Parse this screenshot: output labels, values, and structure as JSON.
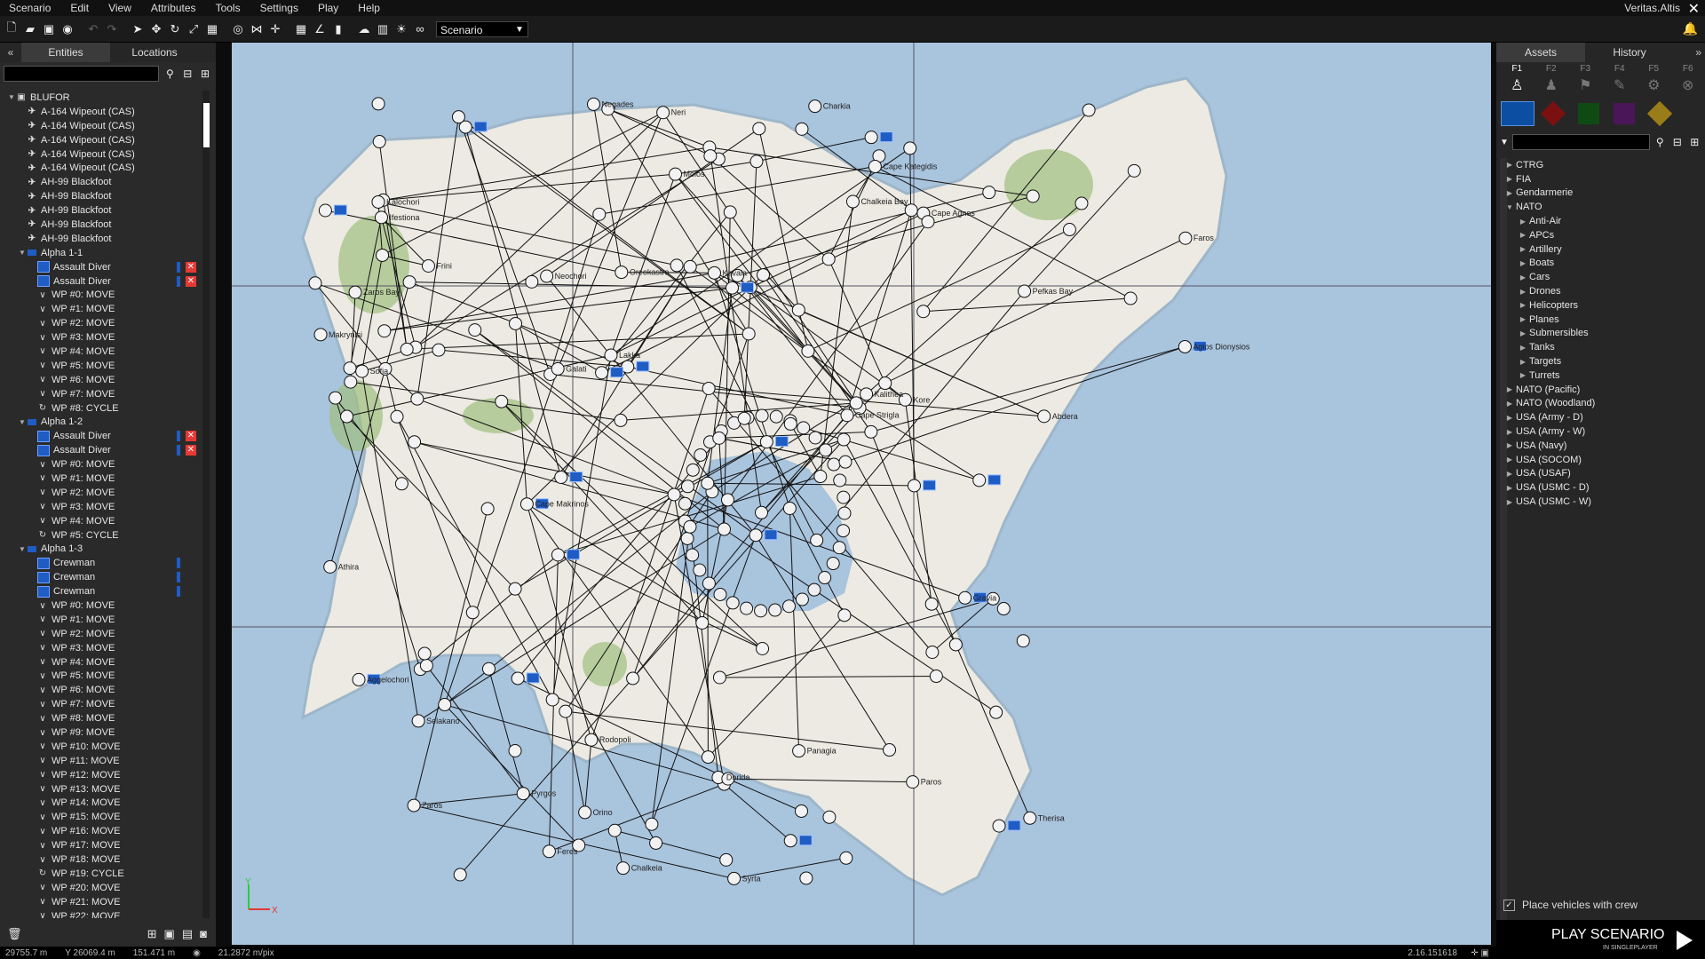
{
  "menu": [
    "Scenario",
    "Edit",
    "View",
    "Attributes",
    "Tools",
    "Settings",
    "Play",
    "Help"
  ],
  "scenario_name": "Veritas.Altis",
  "toolbar": {
    "layer_select": "Scenario"
  },
  "left_panel": {
    "tabs": [
      "Entities",
      "Locations"
    ],
    "tree": [
      {
        "level": 0,
        "toggle": "▼",
        "icon": "folder",
        "label": "BLUFOR"
      },
      {
        "level": 1,
        "icon": "plane",
        "label": "A-164 Wipeout (CAS)"
      },
      {
        "level": 1,
        "icon": "plane",
        "label": "A-164 Wipeout (CAS)"
      },
      {
        "level": 1,
        "icon": "plane",
        "label": "A-164 Wipeout (CAS)"
      },
      {
        "level": 1,
        "icon": "plane",
        "label": "A-164 Wipeout (CAS)"
      },
      {
        "level": 1,
        "icon": "plane",
        "label": "A-164 Wipeout (CAS)"
      },
      {
        "level": 1,
        "icon": "plane",
        "label": "AH-99 Blackfoot"
      },
      {
        "level": 1,
        "icon": "plane",
        "label": "AH-99 Blackfoot"
      },
      {
        "level": 1,
        "icon": "plane",
        "label": "AH-99 Blackfoot"
      },
      {
        "level": 1,
        "icon": "plane",
        "label": "AH-99 Blackfoot"
      },
      {
        "level": 1,
        "icon": "plane",
        "label": "AH-99 Blackfoot"
      },
      {
        "level": 1,
        "toggle": "▼",
        "icon": "group",
        "label": "Alpha 1-1"
      },
      {
        "level": 2,
        "icon": "unit",
        "label": "Assault Diver",
        "badge": "x"
      },
      {
        "level": 2,
        "icon": "unit",
        "label": "Assault Diver",
        "badge": "x"
      },
      {
        "level": 2,
        "icon": "wp",
        "label": "WP #0: MOVE"
      },
      {
        "level": 2,
        "icon": "wp",
        "label": "WP #1: MOVE"
      },
      {
        "level": 2,
        "icon": "wp",
        "label": "WP #2: MOVE"
      },
      {
        "level": 2,
        "icon": "wp",
        "label": "WP #3: MOVE"
      },
      {
        "level": 2,
        "icon": "wp",
        "label": "WP #4: MOVE"
      },
      {
        "level": 2,
        "icon": "wp",
        "label": "WP #5: MOVE"
      },
      {
        "level": 2,
        "icon": "wp",
        "label": "WP #6: MOVE"
      },
      {
        "level": 2,
        "icon": "wp",
        "label": "WP #7: MOVE"
      },
      {
        "level": 2,
        "icon": "cycle",
        "label": "WP #8: CYCLE"
      },
      {
        "level": 1,
        "toggle": "▼",
        "icon": "group",
        "label": "Alpha 1-2"
      },
      {
        "level": 2,
        "icon": "unit",
        "label": "Assault Diver",
        "badge": "x"
      },
      {
        "level": 2,
        "icon": "unit",
        "label": "Assault Diver",
        "badge": "x"
      },
      {
        "level": 2,
        "icon": "wp",
        "label": "WP #0: MOVE"
      },
      {
        "level": 2,
        "icon": "wp",
        "label": "WP #1: MOVE"
      },
      {
        "level": 2,
        "icon": "wp",
        "label": "WP #2: MOVE"
      },
      {
        "level": 2,
        "icon": "wp",
        "label": "WP #3: MOVE"
      },
      {
        "level": 2,
        "icon": "wp",
        "label": "WP #4: MOVE"
      },
      {
        "level": 2,
        "icon": "cycle",
        "label": "WP #5: CYCLE"
      },
      {
        "level": 1,
        "toggle": "▼",
        "icon": "group",
        "label": "Alpha 1-3"
      },
      {
        "level": 2,
        "icon": "unit",
        "label": "Crewman",
        "badge": "bar"
      },
      {
        "level": 2,
        "icon": "unit",
        "label": "Crewman",
        "badge": "bar"
      },
      {
        "level": 2,
        "icon": "unit",
        "label": "Crewman",
        "badge": "bar"
      },
      {
        "level": 2,
        "icon": "wp",
        "label": "WP #0: MOVE"
      },
      {
        "level": 2,
        "icon": "wp",
        "label": "WP #1: MOVE"
      },
      {
        "level": 2,
        "icon": "wp",
        "label": "WP #2: MOVE"
      },
      {
        "level": 2,
        "icon": "wp",
        "label": "WP #3: MOVE"
      },
      {
        "level": 2,
        "icon": "wp",
        "label": "WP #4: MOVE"
      },
      {
        "level": 2,
        "icon": "wp",
        "label": "WP #5: MOVE"
      },
      {
        "level": 2,
        "icon": "wp",
        "label": "WP #6: MOVE"
      },
      {
        "level": 2,
        "icon": "wp",
        "label": "WP #7: MOVE"
      },
      {
        "level": 2,
        "icon": "wp",
        "label": "WP #8: MOVE"
      },
      {
        "level": 2,
        "icon": "wp",
        "label": "WP #9: MOVE"
      },
      {
        "level": 2,
        "icon": "wp",
        "label": "WP #10: MOVE"
      },
      {
        "level": 2,
        "icon": "wp",
        "label": "WP #11: MOVE"
      },
      {
        "level": 2,
        "icon": "wp",
        "label": "WP #12: MOVE"
      },
      {
        "level": 2,
        "icon": "wp",
        "label": "WP #13: MOVE"
      },
      {
        "level": 2,
        "icon": "wp",
        "label": "WP #14: MOVE"
      },
      {
        "level": 2,
        "icon": "wp",
        "label": "WP #15: MOVE"
      },
      {
        "level": 2,
        "icon": "wp",
        "label": "WP #16: MOVE"
      },
      {
        "level": 2,
        "icon": "wp",
        "label": "WP #17: MOVE"
      },
      {
        "level": 2,
        "icon": "wp",
        "label": "WP #18: MOVE"
      },
      {
        "level": 2,
        "icon": "cycle",
        "label": "WP #19: CYCLE"
      },
      {
        "level": 2,
        "icon": "wp",
        "label": "WP #20: MOVE"
      },
      {
        "level": 2,
        "icon": "wp",
        "label": "WP #21: MOVE"
      },
      {
        "level": 2,
        "icon": "wp",
        "label": "WP #22: MOVE"
      }
    ]
  },
  "right_panel": {
    "tabs": [
      "Assets",
      "History"
    ],
    "fkeys": [
      "F1",
      "F2",
      "F3",
      "F4",
      "F5",
      "F6"
    ],
    "side_colors": [
      "#0b4ea2",
      "#7a1010",
      "#0f4a14",
      "#4a1657",
      "#9a7c18"
    ],
    "assets": [
      {
        "label": "CTRG",
        "toggle": "▶"
      },
      {
        "label": "FIA",
        "toggle": "▶"
      },
      {
        "label": "Gendarmerie",
        "toggle": "▶"
      },
      {
        "label": "NATO",
        "toggle": "▼"
      },
      {
        "label": "Anti-Air",
        "toggle": "▶",
        "child": true
      },
      {
        "label": "APCs",
        "toggle": "▶",
        "child": true
      },
      {
        "label": "Artillery",
        "toggle": "▶",
        "child": true
      },
      {
        "label": "Boats",
        "toggle": "▶",
        "child": true
      },
      {
        "label": "Cars",
        "toggle": "▶",
        "child": true
      },
      {
        "label": "Drones",
        "toggle": "▶",
        "child": true
      },
      {
        "label": "Helicopters",
        "toggle": "▶",
        "child": true
      },
      {
        "label": "Planes",
        "toggle": "▶",
        "child": true
      },
      {
        "label": "Submersibles",
        "toggle": "▶",
        "child": true
      },
      {
        "label": "Tanks",
        "toggle": "▶",
        "child": true
      },
      {
        "label": "Targets",
        "toggle": "▶",
        "child": true
      },
      {
        "label": "Turrets",
        "toggle": "▶",
        "child": true
      },
      {
        "label": "NATO (Pacific)",
        "toggle": "▶"
      },
      {
        "label": "NATO (Woodland)",
        "toggle": "▶"
      },
      {
        "label": "USA (Army - D)",
        "toggle": "▶"
      },
      {
        "label": "USA (Army - W)",
        "toggle": "▶"
      },
      {
        "label": "USA (Navy)",
        "toggle": "▶"
      },
      {
        "label": "USA (SOCOM)",
        "toggle": "▶"
      },
      {
        "label": "USA (USAF)",
        "toggle": "▶"
      },
      {
        "label": "USA (USMC - D)",
        "toggle": "▶"
      },
      {
        "label": "USA (USMC - W)",
        "toggle": "▶"
      }
    ],
    "place_with_crew": "Place vehicles with crew",
    "play_label": "PLAY SCENARIO",
    "play_sub": "IN SINGLEPLAYER"
  },
  "map": {
    "labels": [
      "Cape Strigla",
      "Cape Agnos",
      "Faros",
      "Kavala",
      "Pyrgos",
      "Frini",
      "Agios Dionysios",
      "Neochori",
      "Charkia",
      "Feres",
      "Selakano",
      "Paros",
      "Panagia",
      "Sofia",
      "Molos",
      "Gravia",
      "Athira",
      "Zaros",
      "Therisa",
      "Kore",
      "Syrta",
      "Negades",
      "Orino",
      "Ifestiona",
      "Aggelochori",
      "Neri",
      "Oreokastro",
      "Abdera",
      "Galati",
      "Lakka",
      "Kalithea",
      "Dorida",
      "Chalkeia",
      "Cape Makrinos",
      "Cape Kategidis",
      "Makrynisi",
      "Chalkeia Bay",
      "Zaros Bay",
      "Kalochori",
      "Rodopoli",
      "Pefkas Bay"
    ],
    "axis_y": "Y",
    "axis_x": "X"
  },
  "status": {
    "x": "29755.7 m",
    "y": "Y 26069.4 m",
    "z": "151.471 m",
    "scale": "21.2872 m/pix",
    "version": "2.16.151618"
  }
}
